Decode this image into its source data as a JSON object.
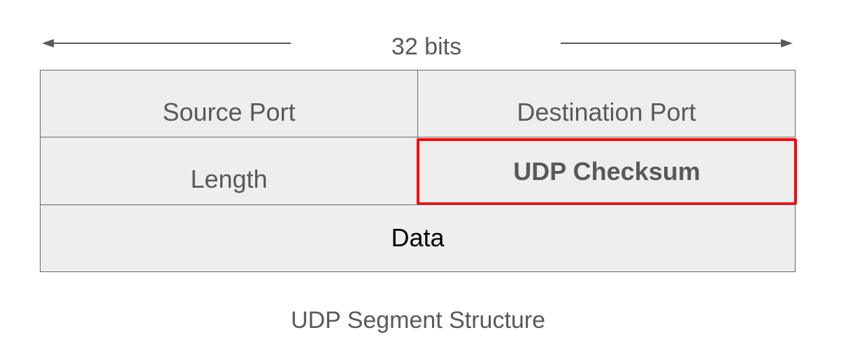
{
  "diagram": {
    "width_label": "32 bits",
    "fields": {
      "source_port": "Source Port",
      "destination_port": "Destination Port",
      "length": "Length",
      "checksum": "UDP Checksum",
      "data": "Data"
    },
    "caption": "UDP Segment Structure"
  },
  "colors": {
    "cell_fill": "#eeeeee",
    "border": "#666666",
    "highlight": "#ff0000",
    "text": "#595959"
  }
}
